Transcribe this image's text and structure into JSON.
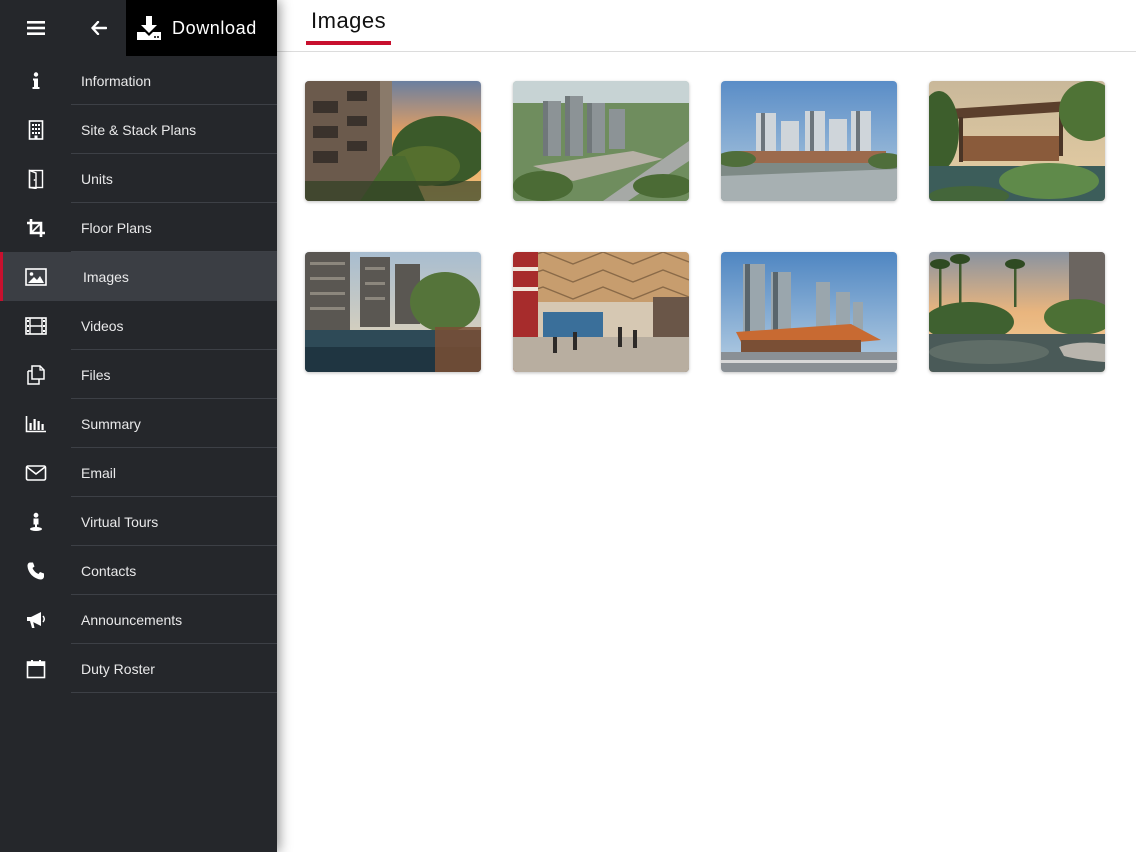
{
  "topbar": {
    "download_label": "Download"
  },
  "nav": [
    {
      "label": "Information",
      "icon": "info-icon"
    },
    {
      "label": "Site & Stack Plans",
      "icon": "building-icon"
    },
    {
      "label": "Units",
      "icon": "door-icon"
    },
    {
      "label": "Floor Plans",
      "icon": "crop-icon"
    },
    {
      "label": "Images",
      "icon": "image-icon",
      "active": true
    },
    {
      "label": "Videos",
      "icon": "film-icon"
    },
    {
      "label": "Files",
      "icon": "files-icon"
    },
    {
      "label": "Summary",
      "icon": "bar-chart-icon"
    },
    {
      "label": "Email",
      "icon": "envelope-icon"
    },
    {
      "label": "Virtual Tours",
      "icon": "person-icon"
    },
    {
      "label": "Contacts",
      "icon": "phone-icon"
    },
    {
      "label": "Announcements",
      "icon": "megaphone-icon"
    },
    {
      "label": "Duty Roster",
      "icon": "calendar-icon"
    }
  ],
  "main": {
    "tab_title": "Images"
  },
  "colors": {
    "accent": "#c8102e",
    "sidebar_bg": "#25272b",
    "active_bg": "#3b3e44"
  },
  "gallery": [
    {
      "name": "photo-condo-walkway-sunset"
    },
    {
      "name": "photo-aerial-towers"
    },
    {
      "name": "photo-towers-daytime"
    },
    {
      "name": "photo-pavilion-garden"
    },
    {
      "name": "photo-pool-towers"
    },
    {
      "name": "photo-mall-interior"
    },
    {
      "name": "photo-mall-exterior"
    },
    {
      "name": "photo-garden-pond"
    }
  ]
}
